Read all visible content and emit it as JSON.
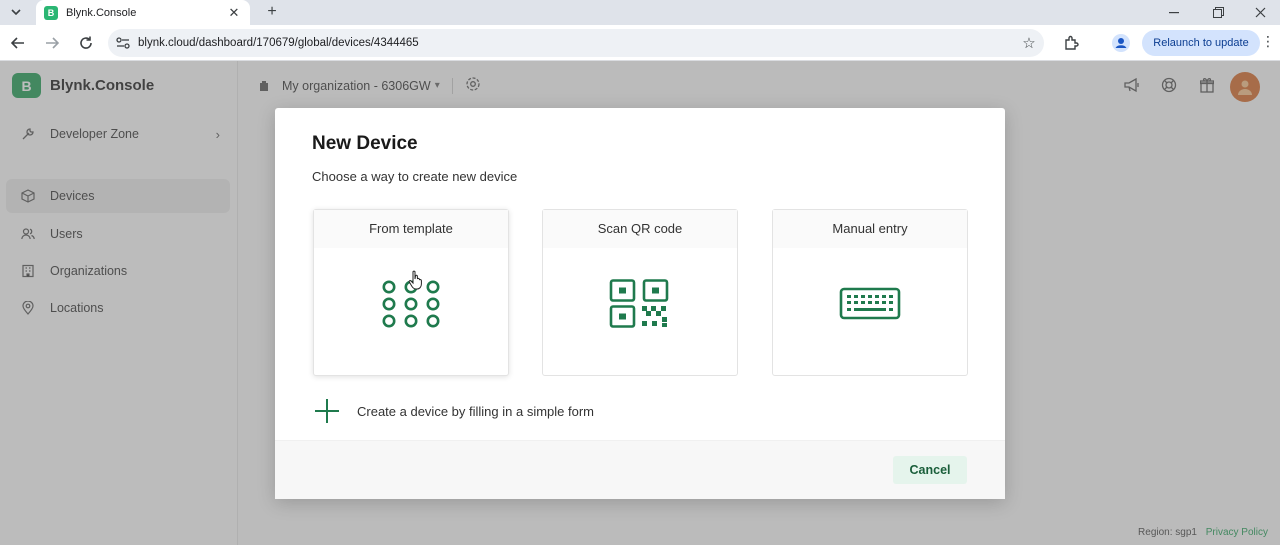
{
  "browser": {
    "tab_title": "Blynk.Console",
    "tab_favicon_letter": "B",
    "url": "blynk.cloud/dashboard/170679/global/devices/4344465",
    "relaunch_label": "Relaunch to update"
  },
  "app": {
    "brand_letter": "B",
    "brand_name": "Blynk.Console",
    "org_name": "My organization - 6306GW",
    "sidebar": {
      "items": [
        {
          "label": "Developer Zone",
          "icon": "wrench-icon"
        },
        {
          "label": "Devices",
          "icon": "cube-icon"
        },
        {
          "label": "Users",
          "icon": "users-icon"
        },
        {
          "label": "Organizations",
          "icon": "building-icon"
        },
        {
          "label": "Locations",
          "icon": "location-pin-icon"
        }
      ]
    },
    "footer": {
      "region": "Region: sgp1",
      "privacy": "Privacy Policy"
    },
    "accent_color": "#1f9d55"
  },
  "modal": {
    "title": "New Device",
    "subtitle": "Choose a way to create new device",
    "options": [
      {
        "label": "From template",
        "icon": "template-grid-icon"
      },
      {
        "label": "Scan QR code",
        "icon": "qr-code-icon"
      },
      {
        "label": "Manual entry",
        "icon": "keyboard-icon"
      }
    ],
    "form_link": "Create a device by filling in a simple form",
    "cancel_label": "Cancel"
  }
}
